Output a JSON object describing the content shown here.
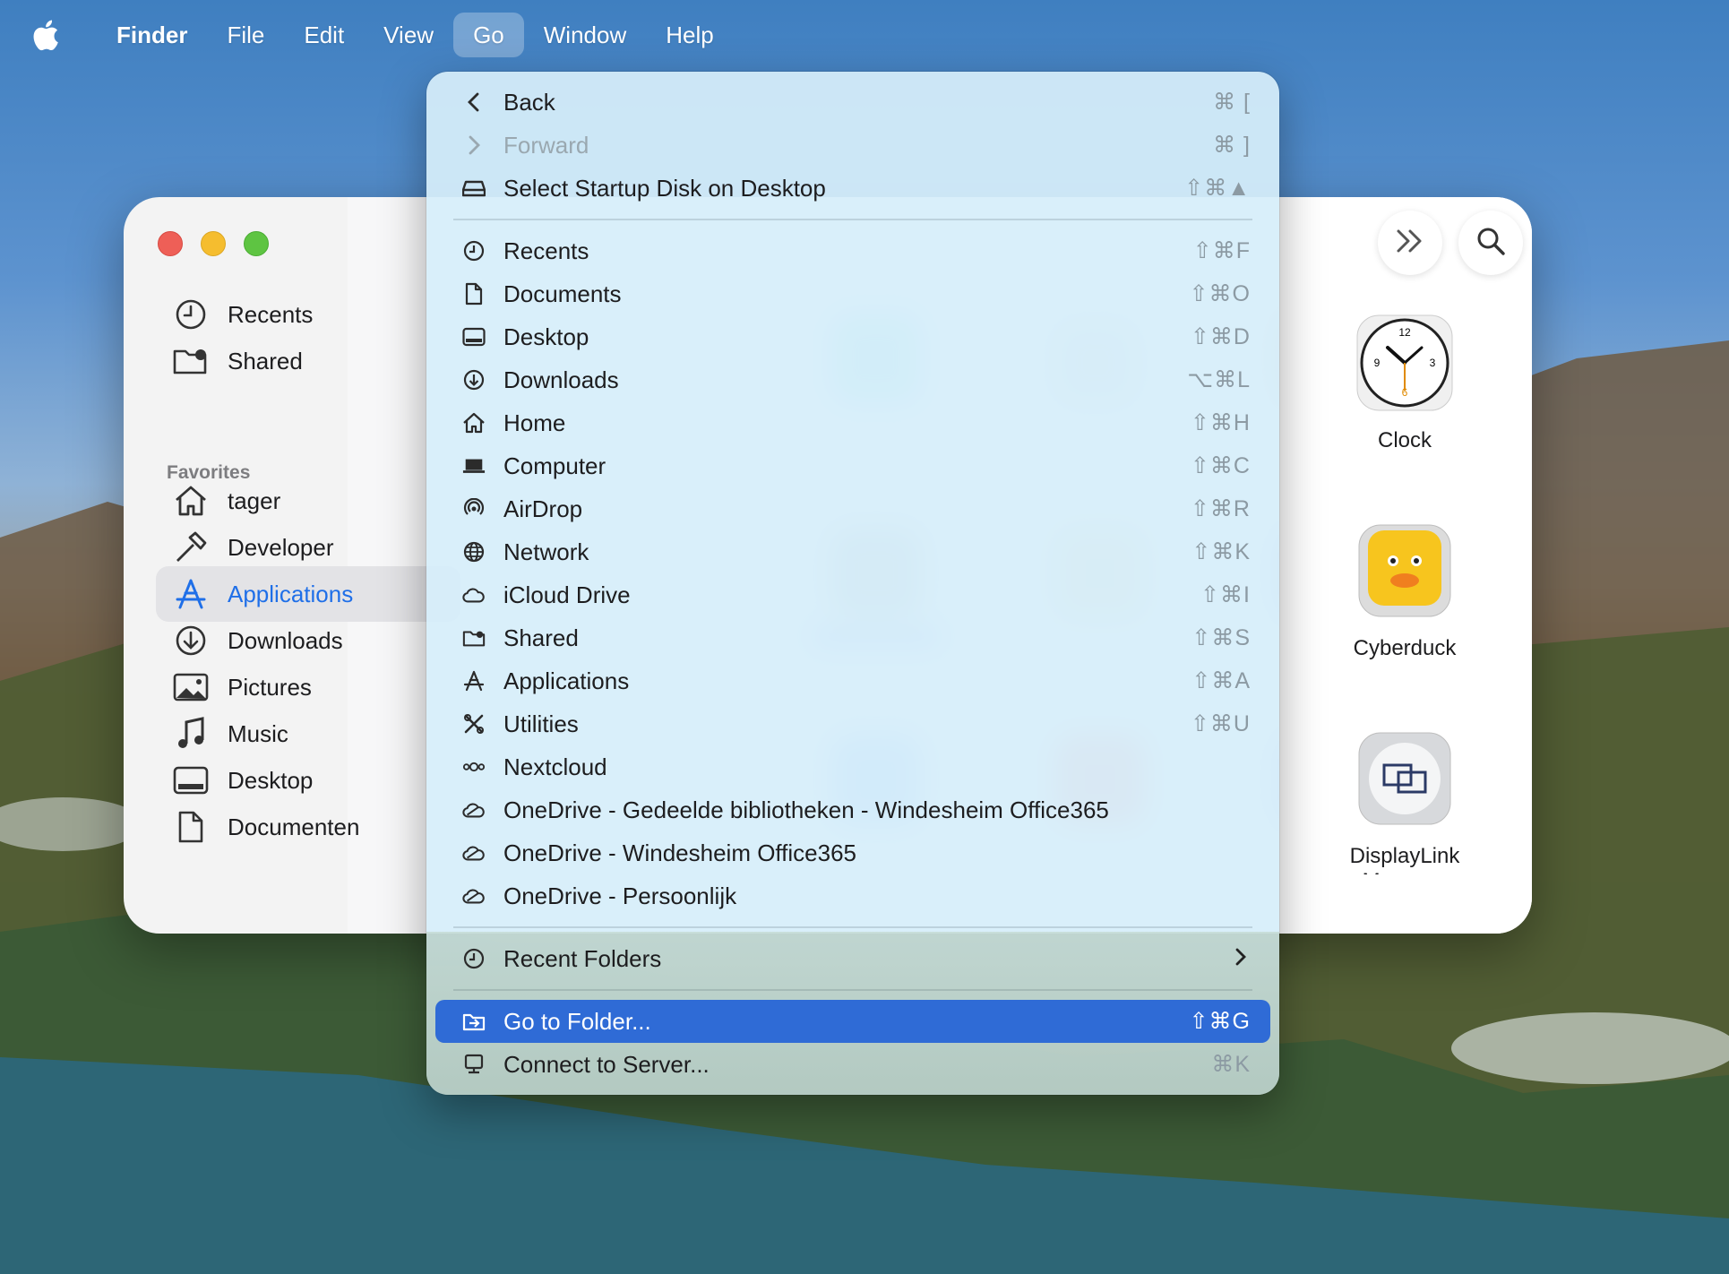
{
  "menubar": {
    "apple_icon": "apple-logo-icon",
    "app_name": "Finder",
    "menus": [
      "File",
      "Edit",
      "View",
      "Go",
      "Window",
      "Help"
    ],
    "active_menu": "Go"
  },
  "finder_window": {
    "sidebar": {
      "top_items": [
        {
          "label": "Recents",
          "icon": "clock-icon"
        },
        {
          "label": "Shared",
          "icon": "shared-folder-icon"
        }
      ],
      "favorites_header": "Favorites",
      "favorites": [
        {
          "label": "tager",
          "icon": "house-icon"
        },
        {
          "label": "Developer",
          "icon": "hammer-icon"
        },
        {
          "label": "Applications",
          "icon": "applications-icon",
          "selected": true
        },
        {
          "label": "Downloads",
          "icon": "download-icon"
        },
        {
          "label": "Pictures",
          "icon": "photo-icon"
        },
        {
          "label": "Music",
          "icon": "music-note-icon"
        },
        {
          "label": "Desktop",
          "icon": "desktop-icon"
        },
        {
          "label": "Documenten",
          "icon": "document-icon"
        }
      ]
    },
    "toolbar": {
      "more_icon": "double-chevron-right-icon",
      "search_icon": "search-icon"
    },
    "apps": [
      {
        "label": "Clock",
        "icon": "clock-app-icon"
      },
      {
        "label": "Cyberduck",
        "icon": "cyberduck-app-icon"
      },
      {
        "label": "DisplayLink Manager",
        "icon": "displaylink-app-icon"
      }
    ]
  },
  "go_menu": {
    "items": [
      {
        "label": "Back",
        "shortcut": "⌘ [",
        "icon": "chevron-left-icon"
      },
      {
        "label": "Forward",
        "shortcut": "⌘ ]",
        "icon": "chevron-right-icon",
        "disabled": true
      },
      {
        "label": "Select Startup Disk on Desktop",
        "shortcut": "⇧⌘▲",
        "icon": "disk-icon"
      },
      {
        "label": "Recents",
        "shortcut": "⇧⌘F",
        "icon": "clock-icon"
      },
      {
        "label": "Documents",
        "shortcut": "⇧⌘O",
        "icon": "document-icon"
      },
      {
        "label": "Desktop",
        "shortcut": "⇧⌘D",
        "icon": "desktop-icon"
      },
      {
        "label": "Downloads",
        "shortcut": "⌥⌘L",
        "icon": "download-icon"
      },
      {
        "label": "Home",
        "shortcut": "⇧⌘H",
        "icon": "house-icon"
      },
      {
        "label": "Computer",
        "shortcut": "⇧⌘C",
        "icon": "laptop-icon"
      },
      {
        "label": "AirDrop",
        "shortcut": "⇧⌘R",
        "icon": "airdrop-icon"
      },
      {
        "label": "Network",
        "shortcut": "⇧⌘K",
        "icon": "globe-icon"
      },
      {
        "label": "iCloud Drive",
        "shortcut": "⇧⌘I",
        "icon": "cloud-icon"
      },
      {
        "label": "Shared",
        "shortcut": "⇧⌘S",
        "icon": "shared-folder-icon"
      },
      {
        "label": "Applications",
        "shortcut": "⇧⌘A",
        "icon": "applications-icon"
      },
      {
        "label": "Utilities",
        "shortcut": "⇧⌘U",
        "icon": "tools-icon"
      },
      {
        "label": "Nextcloud",
        "shortcut": "",
        "icon": "nextcloud-icon"
      },
      {
        "label": "OneDrive - Gedeelde bibliotheken - Windesheim Office365",
        "shortcut": "",
        "icon": "onedrive-icon"
      },
      {
        "label": "OneDrive - Windesheim Office365",
        "shortcut": "",
        "icon": "onedrive-icon"
      },
      {
        "label": "OneDrive - Persoonlijk",
        "shortcut": "",
        "icon": "onedrive-icon"
      },
      {
        "label": "Recent Folders",
        "shortcut": "",
        "icon": "clock-icon",
        "submenu": true
      },
      {
        "label": "Go to Folder...",
        "shortcut": "⇧⌘G",
        "icon": "folder-arrow-icon",
        "highlighted": true
      },
      {
        "label": "Connect to Server...",
        "shortcut": "⌘K",
        "icon": "server-icon"
      }
    ]
  },
  "colors": {
    "highlight": "#2f6bd6",
    "selected_text": "#1f6fe8",
    "close": "#ee5f57",
    "minimize": "#f5bd2f",
    "maximize": "#5ec442"
  }
}
